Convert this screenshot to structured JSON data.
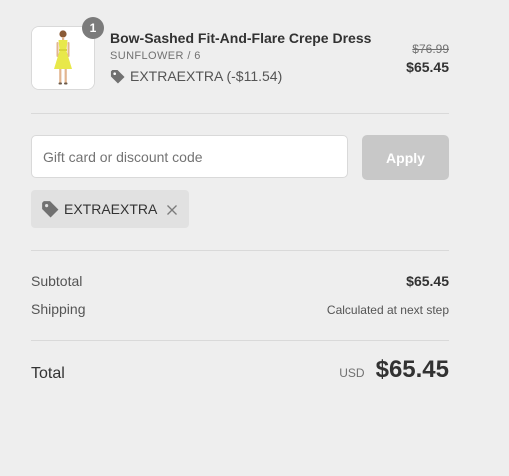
{
  "line_item": {
    "quantity": "1",
    "name": "Bow-Sashed Fit-And-Flare Crepe Dress",
    "variant": "SUNFLOWER / 6",
    "applied_discount": "EXTRAEXTRA (-$11.54)",
    "original_price": "$76.99",
    "price": "$65.45",
    "image_icon": "yellow-dress-photo"
  },
  "discount_form": {
    "placeholder": "Gift card or discount code",
    "value": "",
    "apply_label": "Apply",
    "applied_code": "EXTRAEXTRA",
    "tag_icon": "tag-icon",
    "remove_icon": "close-icon"
  },
  "summary": {
    "subtotal_label": "Subtotal",
    "subtotal_value": "$65.45",
    "shipping_label": "Shipping",
    "shipping_value": "Calculated at next step",
    "total_label": "Total",
    "currency": "USD",
    "total_value": "$65.45"
  },
  "colors": {
    "background": "#eeeeee",
    "apply_disabled": "#c8c8c8",
    "badge": "#7b7b7b",
    "chip": "#e1e1e1",
    "dress": "#e8e84a"
  }
}
